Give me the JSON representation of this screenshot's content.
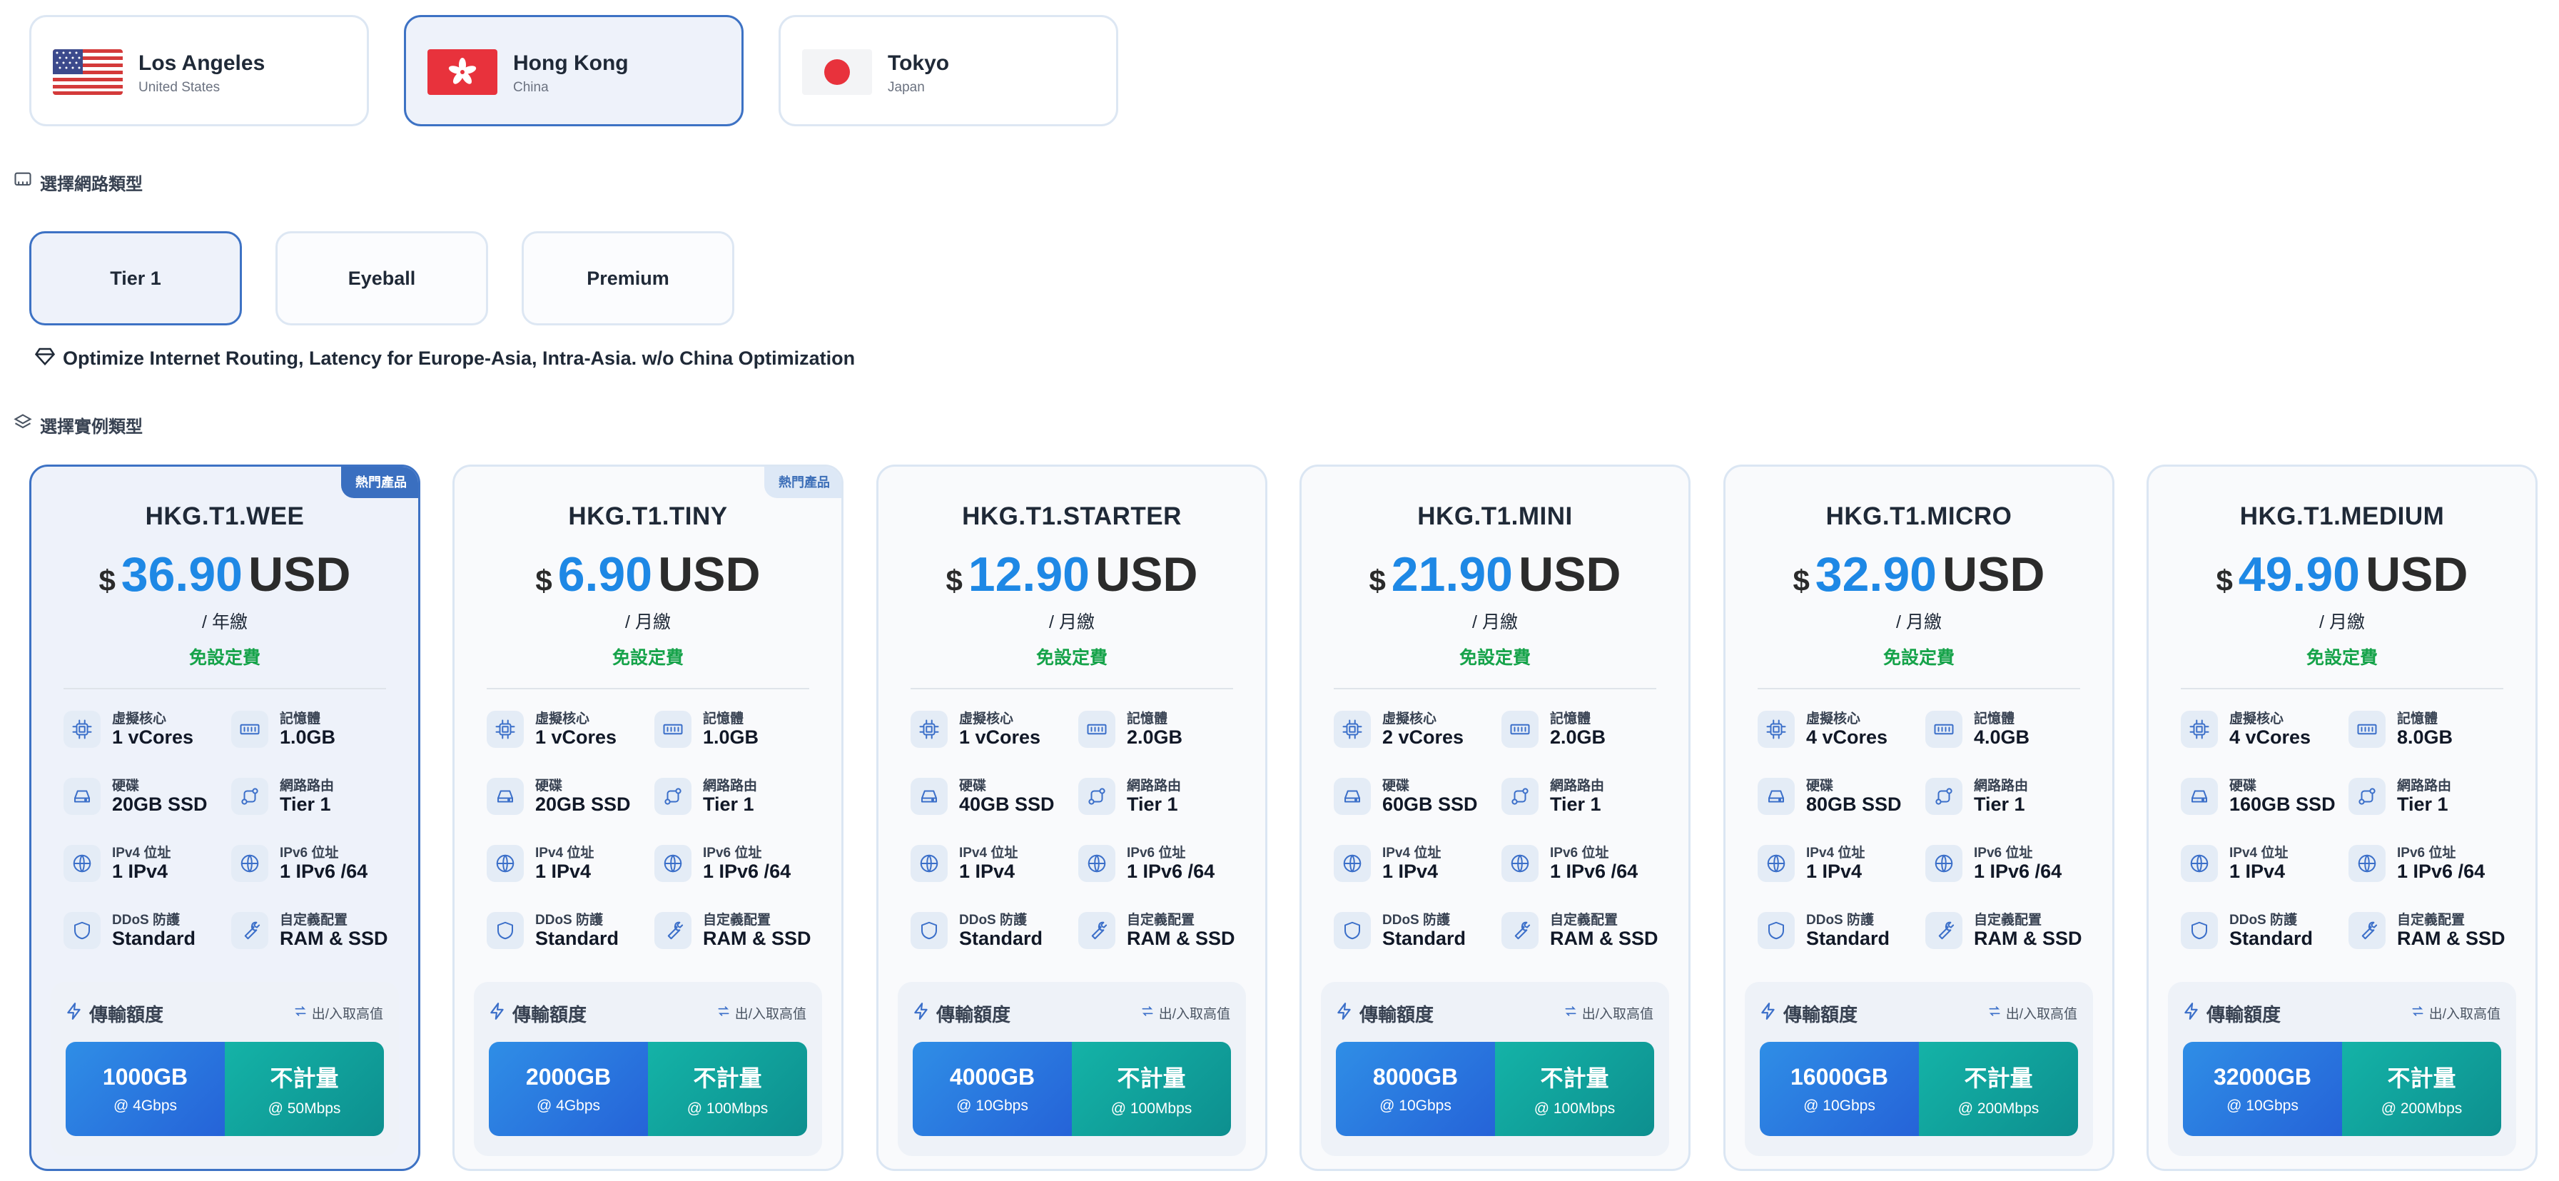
{
  "locations": [
    {
      "name": "Los Angeles",
      "country": "United States",
      "flag": "us-flag-icon"
    },
    {
      "name": "Hong Kong",
      "country": "China",
      "flag": "hk-flag-icon",
      "selected": true
    },
    {
      "name": "Tokyo",
      "country": "Japan",
      "flag": "jp-flag-icon"
    }
  ],
  "network_section": {
    "label": "選擇網路類型",
    "icon": "network-icon"
  },
  "network_types": [
    {
      "label": "Tier 1",
      "selected": true
    },
    {
      "label": "Eyeball"
    },
    {
      "label": "Premium"
    }
  ],
  "network_description": "Optimize Internet Routing, Latency for Europe-Asia, Intra-Asia. w/o China Optimization",
  "instance_section": {
    "label": "選擇實例類型",
    "icon": "layers-icon"
  },
  "spec_labels": {
    "cpu": "虛擬核心",
    "ram": "記憶體",
    "disk": "硬碟",
    "route": "網路路由",
    "ipv4": "IPv4 位址",
    "ipv6": "IPv6 位址",
    "ddos": "DDoS 防護",
    "custom": "自定義配置"
  },
  "traffic_title": "傳輸額度",
  "traffic_note": "出/入取高值",
  "colors": {
    "accent": "#1e88e5",
    "selected_border": "#3d72c4",
    "free_setup": "#16a34a",
    "bw_blue": "#2563d8",
    "bw_teal": "#0d8f8f"
  },
  "plans": [
    {
      "name": "HKG.T1.WEE",
      "currency": "$",
      "price": "36.90",
      "unit": "USD",
      "period": "/ 年繳",
      "setup": "免設定費",
      "badge": "熱門產品",
      "selected": true,
      "cpu": "1 vCores",
      "ram": "1.0GB",
      "disk": "20GB SSD",
      "route": "Tier 1",
      "ipv4": "1 IPv4",
      "ipv6": "1 IPv6 /64",
      "ddos": "Standard",
      "custom": "RAM & SSD",
      "bw_amount": "1000GB",
      "bw_speed": "@ 4Gbps",
      "bw_unmetered": "不計量",
      "bw_unmetered_speed": "@ 50Mbps"
    },
    {
      "name": "HKG.T1.TINY",
      "currency": "$",
      "price": "6.90",
      "unit": "USD",
      "period": "/ 月繳",
      "setup": "免設定費",
      "badge": "熱門產品",
      "cpu": "1 vCores",
      "ram": "1.0GB",
      "disk": "20GB SSD",
      "route": "Tier 1",
      "ipv4": "1 IPv4",
      "ipv6": "1 IPv6 /64",
      "ddos": "Standard",
      "custom": "RAM & SSD",
      "bw_amount": "2000GB",
      "bw_speed": "@ 4Gbps",
      "bw_unmetered": "不計量",
      "bw_unmetered_speed": "@ 100Mbps"
    },
    {
      "name": "HKG.T1.STARTER",
      "currency": "$",
      "price": "12.90",
      "unit": "USD",
      "period": "/ 月繳",
      "setup": "免設定費",
      "cpu": "1 vCores",
      "ram": "2.0GB",
      "disk": "40GB SSD",
      "route": "Tier 1",
      "ipv4": "1 IPv4",
      "ipv6": "1 IPv6 /64",
      "ddos": "Standard",
      "custom": "RAM & SSD",
      "bw_amount": "4000GB",
      "bw_speed": "@ 10Gbps",
      "bw_unmetered": "不計量",
      "bw_unmetered_speed": "@ 100Mbps"
    },
    {
      "name": "HKG.T1.MINI",
      "currency": "$",
      "price": "21.90",
      "unit": "USD",
      "period": "/ 月繳",
      "setup": "免設定費",
      "cpu": "2 vCores",
      "ram": "2.0GB",
      "disk": "60GB SSD",
      "route": "Tier 1",
      "ipv4": "1 IPv4",
      "ipv6": "1 IPv6 /64",
      "ddos": "Standard",
      "custom": "RAM & SSD",
      "bw_amount": "8000GB",
      "bw_speed": "@ 10Gbps",
      "bw_unmetered": "不計量",
      "bw_unmetered_speed": "@ 100Mbps"
    },
    {
      "name": "HKG.T1.MICRO",
      "currency": "$",
      "price": "32.90",
      "unit": "USD",
      "period": "/ 月繳",
      "setup": "免設定費",
      "cpu": "4 vCores",
      "ram": "4.0GB",
      "disk": "80GB SSD",
      "route": "Tier 1",
      "ipv4": "1 IPv4",
      "ipv6": "1 IPv6 /64",
      "ddos": "Standard",
      "custom": "RAM & SSD",
      "bw_amount": "16000GB",
      "bw_speed": "@ 10Gbps",
      "bw_unmetered": "不計量",
      "bw_unmetered_speed": "@ 200Mbps"
    },
    {
      "name": "HKG.T1.MEDIUM",
      "currency": "$",
      "price": "49.90",
      "unit": "USD",
      "period": "/ 月繳",
      "setup": "免設定費",
      "cpu": "4 vCores",
      "ram": "8.0GB",
      "disk": "160GB SSD",
      "route": "Tier 1",
      "ipv4": "1 IPv4",
      "ipv6": "1 IPv6 /64",
      "ddos": "Standard",
      "custom": "RAM & SSD",
      "bw_amount": "32000GB",
      "bw_speed": "@ 10Gbps",
      "bw_unmetered": "不計量",
      "bw_unmetered_speed": "@ 200Mbps"
    }
  ]
}
